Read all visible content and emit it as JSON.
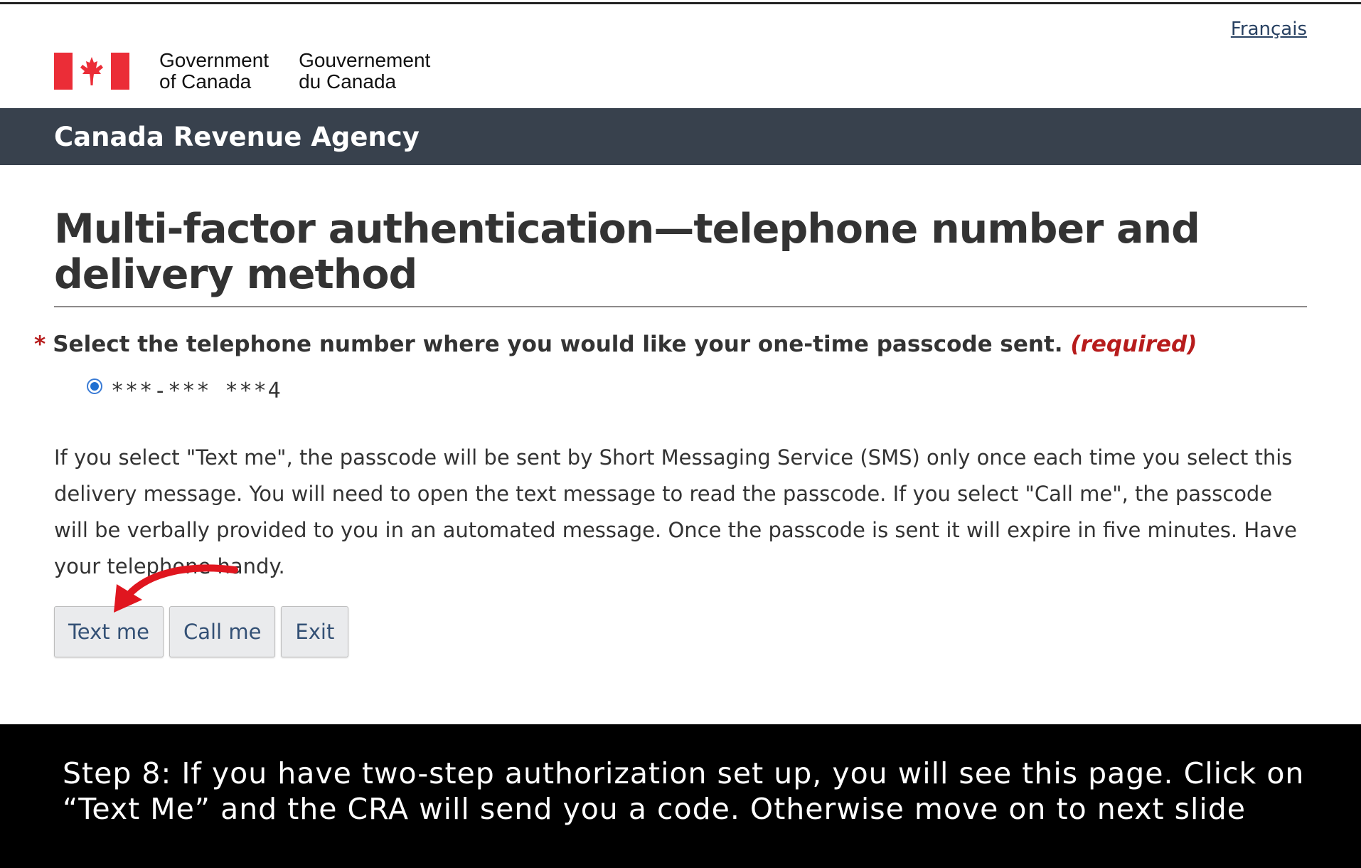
{
  "language_toggle": "Français",
  "signature": {
    "english_line1": "Government",
    "english_line2": "of Canada",
    "french_line1": "Gouvernement",
    "french_line2": "du Canada"
  },
  "banner": {
    "title": "Canada Revenue Agency"
  },
  "page": {
    "title": "Multi-factor authentication—telephone number and delivery method",
    "question": {
      "required_marker": "*",
      "label": "Select the telephone number where you would like your one-time passcode sent.",
      "required_text": "(required)"
    },
    "phone_option": {
      "value": "***-***  ***4",
      "selected": true
    },
    "info_text": "If you select \"Text me\", the passcode will be sent by Short Messaging Service (SMS) only once each time you select this delivery message. You will need to open the text message to read the passcode. If you select \"Call me\", the passcode will be verbally provided to you in an automated message. Once the passcode is sent it will expire in five minutes. Have your telephone handy.",
    "buttons": {
      "text_me": "Text me",
      "call_me": "Call me",
      "exit": "Exit"
    }
  },
  "caption": {
    "text": "Step 8: If you have two-step authorization set up, you will see this page. Click on “Text Me” and the CRA will send you a code. Otherwise move on to next slide"
  },
  "colors": {
    "banner_bg": "#38414d",
    "required_red": "#b71c1c",
    "flag_red": "#eb2d37",
    "arrow_red": "#e0161f",
    "button_text": "#335075",
    "caption_bg": "#000000"
  }
}
